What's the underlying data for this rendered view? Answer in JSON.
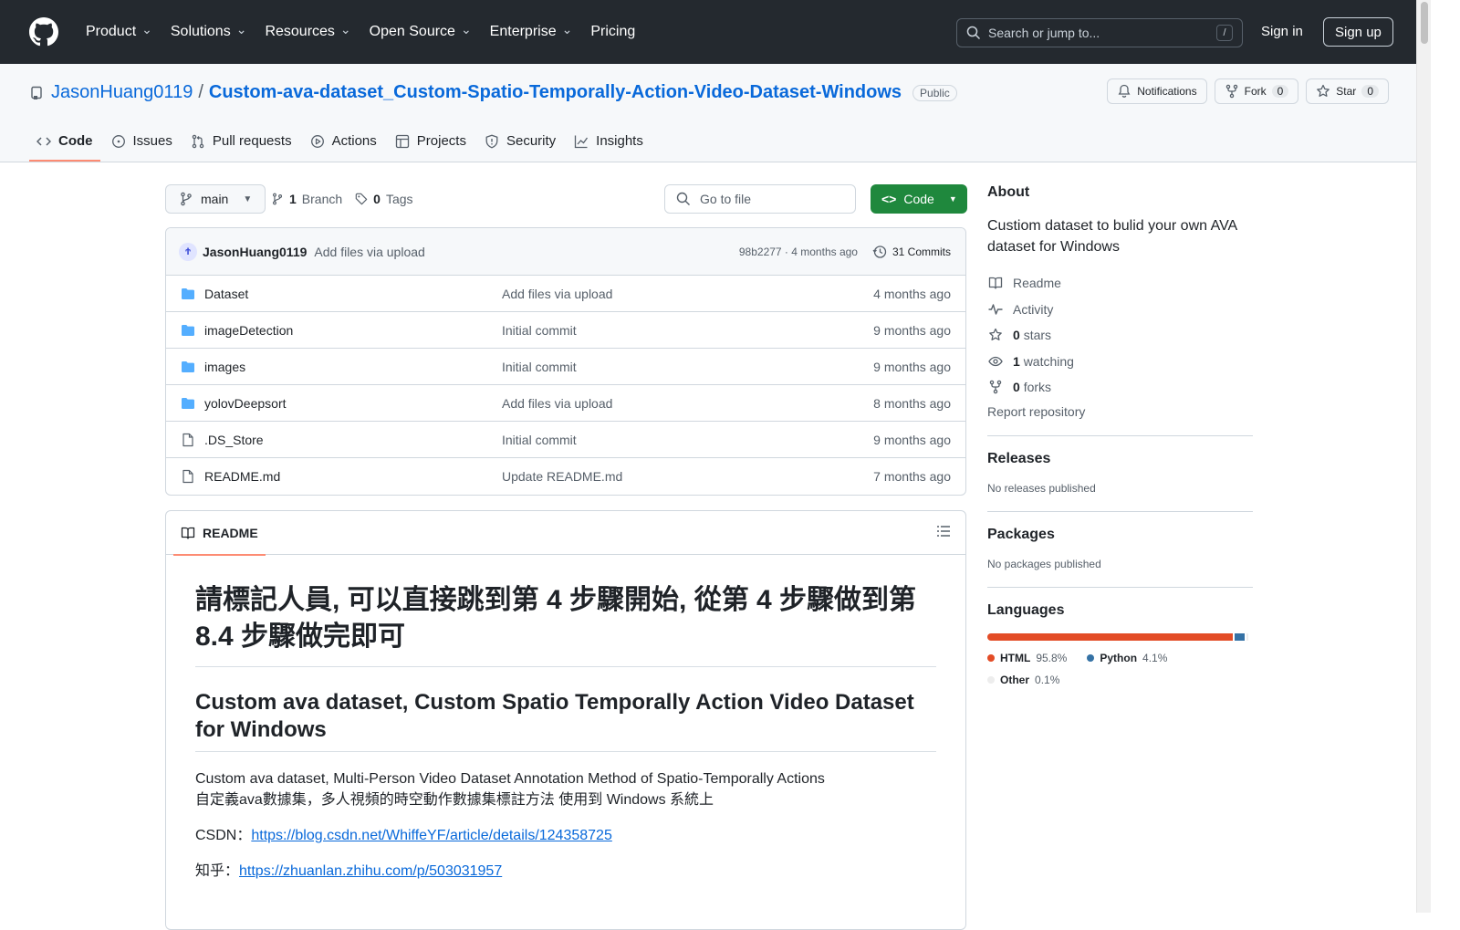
{
  "header": {
    "nav": [
      {
        "label": "Product",
        "dropdown": true
      },
      {
        "label": "Solutions",
        "dropdown": true
      },
      {
        "label": "Resources",
        "dropdown": true
      },
      {
        "label": "Open Source",
        "dropdown": true
      },
      {
        "label": "Enterprise",
        "dropdown": true
      },
      {
        "label": "Pricing",
        "dropdown": false
      }
    ],
    "search_placeholder": "Search or jump to...",
    "search_shortcut": "/",
    "signin": "Sign in",
    "signup": "Sign up"
  },
  "repo": {
    "owner": "JasonHuang0119",
    "separator": "/",
    "name": "Custom-ava-dataset_Custom-Spatio-Temporally-Action-Video-Dataset-Windows",
    "visibility": "Public",
    "notifications": "Notifications",
    "fork_label": "Fork",
    "fork_count": "0",
    "star_label": "Star",
    "star_count": "0"
  },
  "tabs": [
    {
      "label": "Code",
      "icon": "code-icon",
      "active": true
    },
    {
      "label": "Issues",
      "icon": "issue-icon",
      "active": false
    },
    {
      "label": "Pull requests",
      "icon": "pull-request-icon",
      "active": false
    },
    {
      "label": "Actions",
      "icon": "play-icon",
      "active": false
    },
    {
      "label": "Projects",
      "icon": "table-icon",
      "active": false
    },
    {
      "label": "Security",
      "icon": "shield-icon",
      "active": false
    },
    {
      "label": "Insights",
      "icon": "graph-icon",
      "active": false
    }
  ],
  "branch": {
    "current": "main",
    "branch_count": "1",
    "branch_label": "Branch",
    "tag_count": "0",
    "tag_label": "Tags",
    "goto_placeholder": "Go to file",
    "code_button": "Code"
  },
  "latest_commit": {
    "author": "JasonHuang0119",
    "message": "Add files via upload",
    "hash_time": "98b2277 · 4 months ago",
    "commits": "31 Commits"
  },
  "files": [
    {
      "name": "Dataset",
      "type": "folder",
      "message": "Add files via upload",
      "date": "4 months ago"
    },
    {
      "name": "imageDetection",
      "type": "folder",
      "message": "Initial commit",
      "date": "9 months ago"
    },
    {
      "name": "images",
      "type": "folder",
      "message": "Initial commit",
      "date": "9 months ago"
    },
    {
      "name": "yolovDeepsort",
      "type": "folder",
      "message": "Add files via upload",
      "date": "8 months ago"
    },
    {
      "name": ".DS_Store",
      "type": "file",
      "message": "Initial commit",
      "date": "9 months ago"
    },
    {
      "name": "README.md",
      "type": "file",
      "message": "Update README.md",
      "date": "7 months ago"
    }
  ],
  "readme": {
    "tab_label": "README",
    "h1": "請標記人員, 可以直接跳到第 4 步驟開始, 從第 4 步驟做到第 8.4 步驟做完即可",
    "h2": "Custom ava dataset, Custom Spatio Temporally Action Video Dataset for Windows",
    "p1_line1": "Custom ava dataset, Multi-Person Video Dataset Annotation Method of Spatio-Temporally Actions",
    "p1_line2": "自定義ava數據集，多人視頻的時空動作數據集標註方法 使用到 Windows 系統上",
    "csdn_label": "CSDN：",
    "csdn_link": "https://blog.csdn.net/WhiffeYF/article/details/124358725",
    "zhihu_label": "知乎：",
    "zhihu_link": "https://zhuanlan.zhihu.com/p/503031957"
  },
  "about": {
    "title": "About",
    "description": "Custiom dataset to bulid your own AVA dataset for Windows",
    "readme": "Readme",
    "activity": "Activity",
    "stars_count": "0",
    "stars_label": "stars",
    "watching_count": "1",
    "watching_label": "watching",
    "forks_count": "0",
    "forks_label": "forks",
    "report": "Report repository"
  },
  "releases": {
    "title": "Releases",
    "text": "No releases published"
  },
  "packages": {
    "title": "Packages",
    "text": "No packages published"
  },
  "languages": {
    "title": "Languages",
    "items": [
      {
        "name": "HTML",
        "percent": "95.8%",
        "value": 95.8,
        "color": "#e34c26"
      },
      {
        "name": "Python",
        "percent": "4.1%",
        "value": 4.1,
        "color": "#3572A5"
      },
      {
        "name": "Other",
        "percent": "0.1%",
        "value": 0.1,
        "color": "#ededed"
      }
    ]
  }
}
